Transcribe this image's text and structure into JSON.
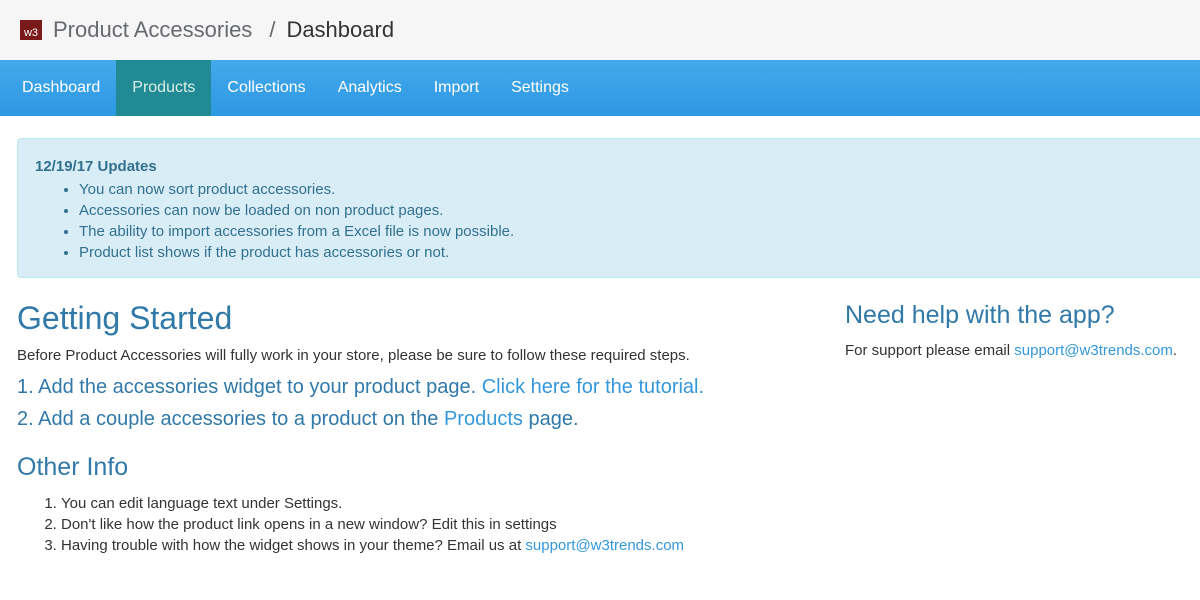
{
  "header": {
    "logo_text": "w3",
    "app_name": "Product Accessories",
    "separator": "/",
    "page_name": "Dashboard"
  },
  "nav": {
    "items": [
      {
        "label": "Dashboard",
        "active": false
      },
      {
        "label": "Products",
        "active": true
      },
      {
        "label": "Collections",
        "active": false
      },
      {
        "label": "Analytics",
        "active": false
      },
      {
        "label": "Import",
        "active": false
      },
      {
        "label": "Settings",
        "active": false
      }
    ]
  },
  "updates": {
    "title": "12/19/17 Updates",
    "items": [
      "You can now sort product accessories.",
      "Accessories can now be loaded on non product pages.",
      "The ability to import accessories from a Excel file is now possible.",
      "Product list shows if the product has accessories or not."
    ]
  },
  "getting_started": {
    "title": "Getting Started",
    "intro": "Before Product Accessories will fully work in your store, please be sure to follow these required steps.",
    "step1_text": "1. Add the accessories widget to your product page.",
    "step1_link": "Click here for the tutorial.",
    "step2_prefix": "2. Add a couple accessories to a product on the",
    "step2_link": "Products",
    "step2_suffix": "page."
  },
  "other_info": {
    "title": "Other Info",
    "item1": "You can edit language text under Settings.",
    "item2": "Don't like how the product link opens in a new window? Edit this in settings",
    "item3_prefix": "Having trouble with how the widget shows in your theme? Email us at",
    "item3_link": "support@w3trends.com"
  },
  "help": {
    "title": "Need help with the app?",
    "text_prefix": "For support please email",
    "email": "support@w3trends.com",
    "text_suffix": "."
  },
  "colors": {
    "nav_blue": "#2d98e3",
    "nav_active": "#228a94",
    "heading_blue": "#3079a8",
    "link_blue": "#3498db",
    "alert_bg": "#d9edf7",
    "alert_text": "#31708f"
  }
}
